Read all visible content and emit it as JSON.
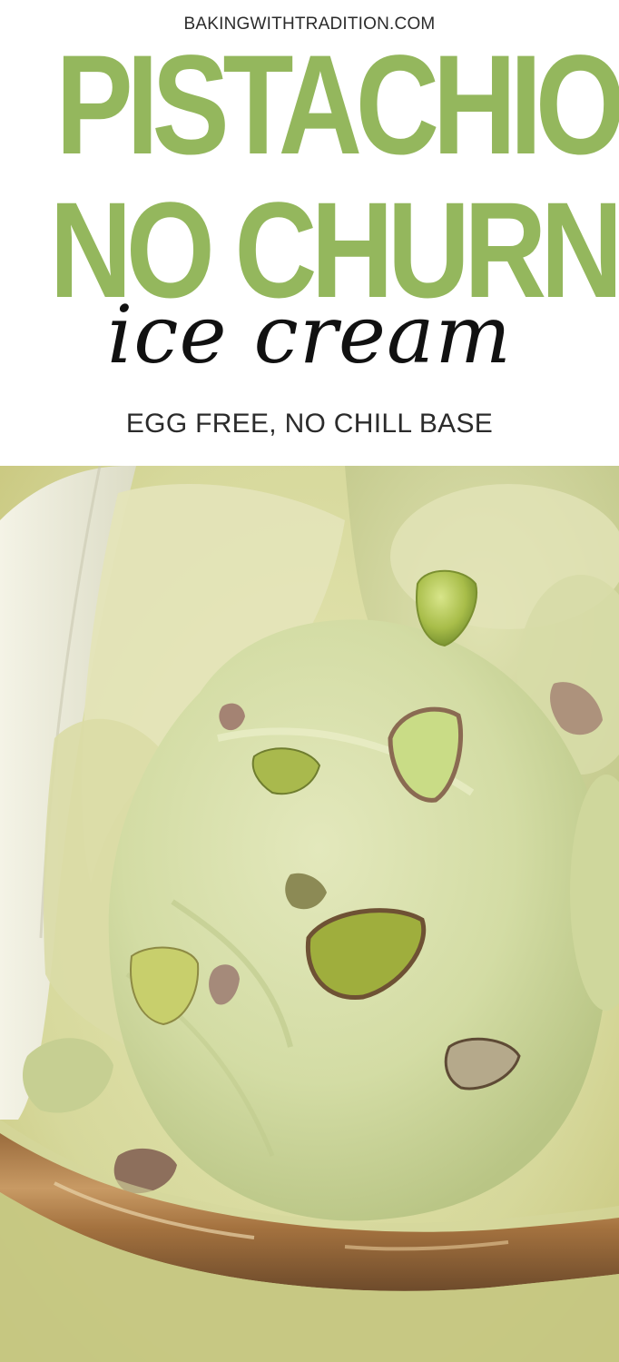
{
  "header": {
    "site_url": "BAKINGWITHTRADITION.COM",
    "title_line_1": "PISTACHIO",
    "title_line_2": "NO CHURN",
    "script_line": "ice cream",
    "subtitle": "EGG FREE, NO CHILL BASE"
  },
  "colors": {
    "title_green": "#94b75d",
    "background": "#ffffff",
    "text_dark": "#2b2b2b"
  },
  "photo": {
    "subject": "scoop of pistachio ice cream with chopped pistachios in a metal loaf pan"
  }
}
